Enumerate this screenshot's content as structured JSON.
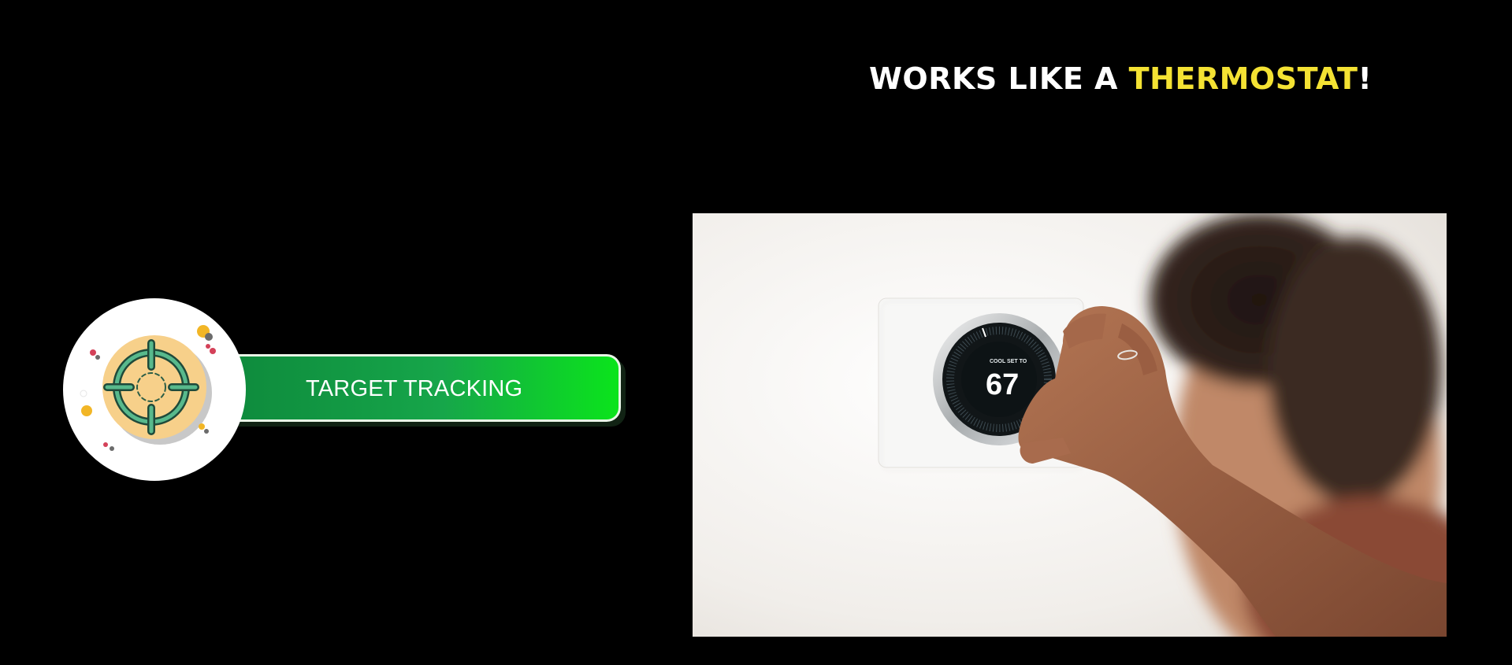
{
  "headline": {
    "prefix": "WORKS LIKE A ",
    "highlight": "THERMOSTAT",
    "suffix": "!",
    "accent_color": "#f4e233"
  },
  "badge": {
    "label": "TARGET TRACKING",
    "icon": "crosshair-target-icon",
    "bar_color_start": "#0e8a3c",
    "bar_color_end": "#0be41c"
  },
  "photo": {
    "description_icon": "thermostat-hand-photo",
    "thermostat_mode": "COOL SET TO",
    "thermostat_temp": "67"
  }
}
